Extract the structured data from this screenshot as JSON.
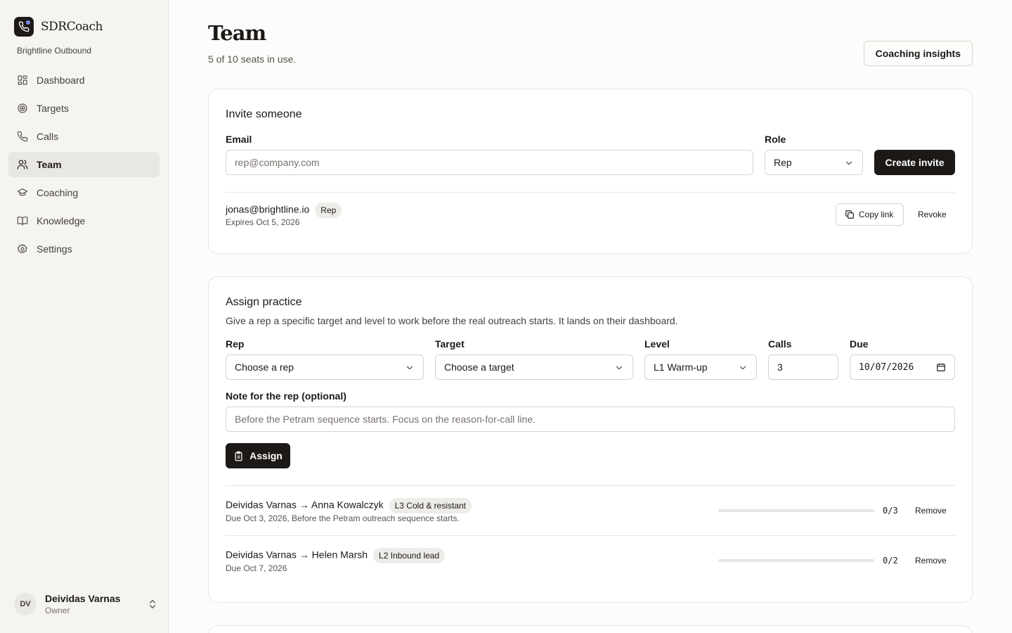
{
  "app": {
    "name": "SDRCoach",
    "workspace": "Brightline Outbound"
  },
  "sidebar": {
    "items": [
      {
        "label": "Dashboard",
        "icon": "dashboard-icon",
        "active": false
      },
      {
        "label": "Targets",
        "icon": "target-icon",
        "active": false
      },
      {
        "label": "Calls",
        "icon": "phone-icon",
        "active": false
      },
      {
        "label": "Team",
        "icon": "users-icon",
        "active": true
      },
      {
        "label": "Coaching",
        "icon": "graduation-cap-icon",
        "active": false
      },
      {
        "label": "Knowledge",
        "icon": "book-icon",
        "active": false
      },
      {
        "label": "Settings",
        "icon": "gear-icon",
        "active": false
      }
    ],
    "user": {
      "initials": "DV",
      "name": "Deividas Varnas",
      "role": "Owner"
    }
  },
  "header": {
    "title": "Team",
    "subtitle": "5 of 10 seats in use.",
    "insights_label": "Coaching insights"
  },
  "invite": {
    "title": "Invite someone",
    "email_label": "Email",
    "email_placeholder": "rep@company.com",
    "role_label": "Role",
    "role_value": "Rep",
    "create_label": "Create invite",
    "pending": [
      {
        "email": "jonas@brightline.io",
        "role": "Rep",
        "expires": "Expires Oct 5, 2026",
        "copy_label": "Copy link",
        "revoke_label": "Revoke"
      }
    ]
  },
  "assign": {
    "title": "Assign practice",
    "description": "Give a rep a specific target and level to work before the real outreach starts. It lands on their dashboard.",
    "rep_label": "Rep",
    "rep_value": "Choose a rep",
    "target_label": "Target",
    "target_value": "Choose a target",
    "level_label": "Level",
    "level_value": "L1 Warm-up",
    "calls_label": "Calls",
    "calls_value": "3",
    "due_label": "Due",
    "due_value": "10/07/2026",
    "note_label": "Note for the rep (optional)",
    "note_placeholder": "Before the Petram sequence starts. Focus on the reason-for-call line.",
    "assign_label": "Assign",
    "assignments": [
      {
        "title": "Deividas Varnas → Anna Kowalczyk",
        "level": "L3 Cold & resistant",
        "sub": "Due Oct 3, 2026, Before the Petram outreach sequence starts.",
        "progress": 0,
        "count": "0/3",
        "remove_label": "Remove"
      },
      {
        "title": "Deividas Varnas → Helen Marsh",
        "level": "L2 Inbound lead",
        "sub": "Due Oct 7, 2026",
        "progress": 0,
        "count": "0/2",
        "remove_label": "Remove"
      }
    ]
  }
}
